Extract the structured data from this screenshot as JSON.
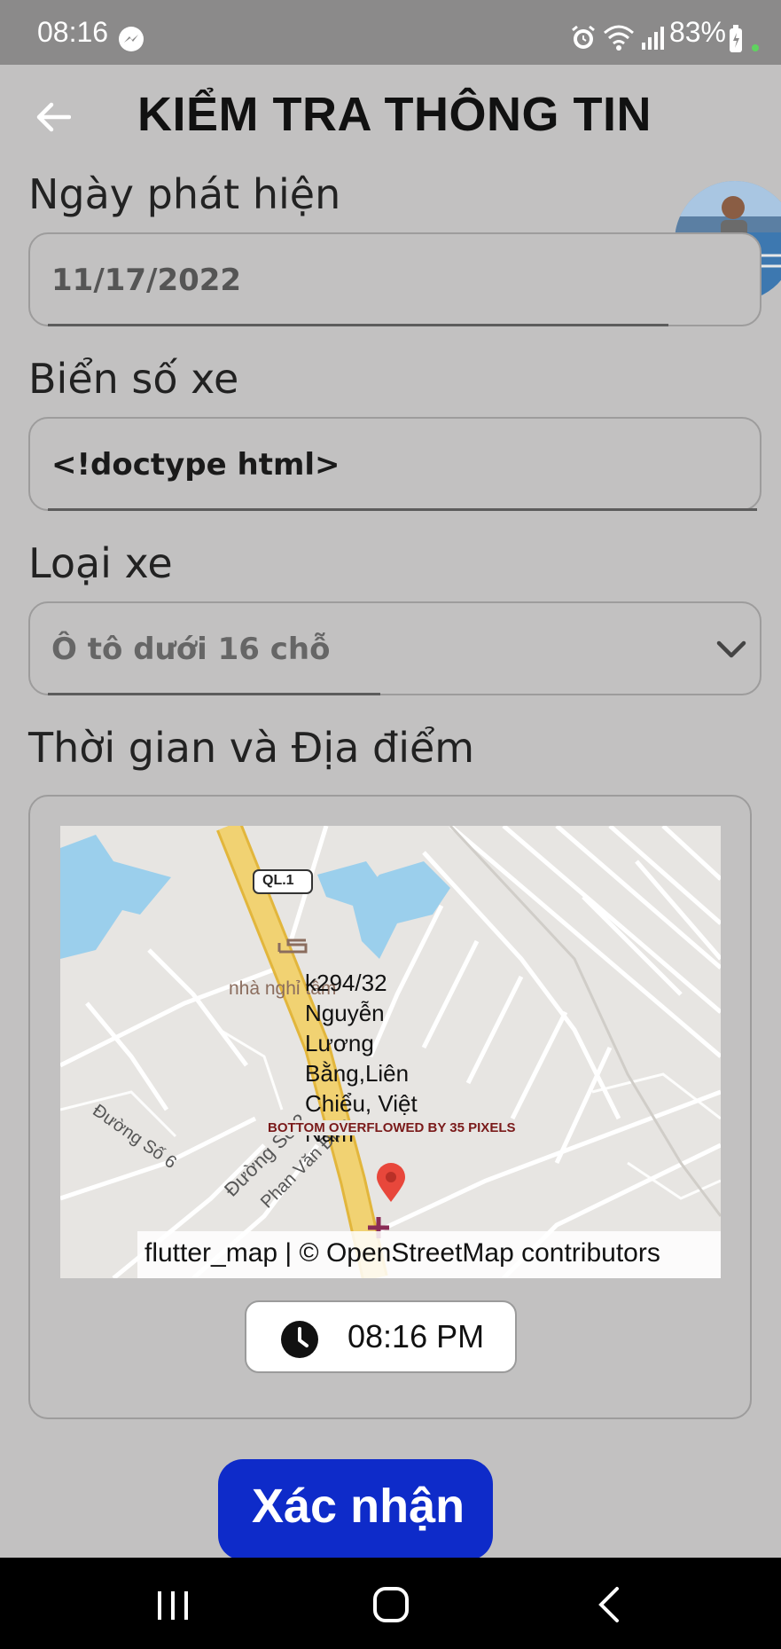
{
  "status_bar": {
    "time": "08:16",
    "battery": "83%"
  },
  "app_bar": {
    "title": "KIỂM TRA THÔNG TIN"
  },
  "form": {
    "date_label": "Ngày phát hiện",
    "date_value": "11/17/2022",
    "plate_label": "Biển số xe",
    "plate_value": "<!doctype html>",
    "type_label": "Loại xe",
    "type_value": "Ô tô dưới 16 chỗ",
    "time_place_label": "Thời gian và Địa điểm"
  },
  "map": {
    "road_badge": "QL.1",
    "poi": "nhà nghỉ tâm",
    "address": "k294/32\nNguyễn\nLương\nBằng,Liên\nChiểu, Việt\nNam",
    "street_1": "Đường Số 6",
    "street_2": "Đường Số 2",
    "street_3": "Phan Văn Định",
    "overflow_banner": "BOTTOM OVERFLOWED BY 35 PIXELS",
    "attribution": "flutter_map | © OpenStreetMap contributors"
  },
  "time_button": {
    "label": "08:16 PM"
  },
  "confirm_button": {
    "label": "Xác nhận"
  },
  "colors": {
    "background": "#c2c1c1",
    "accent": "#0e2bc9",
    "status_bar": "#8b8a8a",
    "marker": "#e8473b",
    "water": "#9bcfec",
    "highway": "#f1d272"
  }
}
